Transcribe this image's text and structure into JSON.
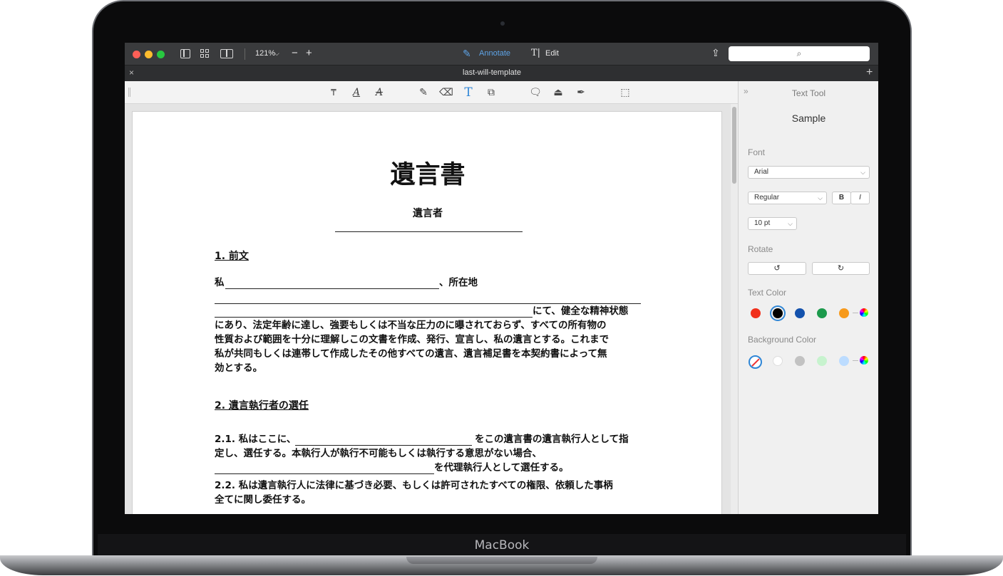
{
  "device": {
    "brand": "MacBook"
  },
  "window": {
    "zoom": "121%",
    "modes": {
      "annotate": "Annotate",
      "edit": "Edit"
    },
    "tab": {
      "title": "last-will-template"
    },
    "search_icon": "magnifier-icon"
  },
  "colors": {
    "accent": "#2f86d6",
    "traffic_red": "#fe5f57",
    "traffic_yellow": "#febc2e",
    "traffic_green": "#28c840"
  },
  "document": {
    "title": "遺言書",
    "testator": "遺言者",
    "sections": [
      {
        "heading": "1. 前文"
      },
      {
        "heading": "2. 遺言執行者の選任"
      }
    ],
    "p1_line1_a": "私",
    "p1_line1_b": "、所在地",
    "p1_line3_b": "にて、健全な精神状態",
    "p1_line4": "にあり、法定年齢に達し、強要もしくは不当な圧力のに曝されておらず、すべての所有物の",
    "p1_line5": "性質および範囲を十分に理解しこの文書を作成、発行、宣言し、私の遺言とする。これまで",
    "p1_line6": "私が共同もしくは連帯して作成したその他すべての遺言、遺言補足書を本契約書によって無",
    "p1_line7": "効とする。",
    "p21_a": "2.1. 私はここに、",
    "p21_b": "をこの遺言書の遺言執行人として指",
    "p21_line2": "定し、選任する。本執行人が執行不可能もしくは執行する意思がない場合、",
    "p21_line3_b": "を代理執行人として選任する。",
    "p22_line1": "2.2. 私は遺言執行人に法律に基づき必要、もしくは許可されたすべての権限、依頼した事柄",
    "p22_line2": "全てに関し委任する。"
  },
  "panel": {
    "title": "Text Tool",
    "sample": "Sample",
    "font_label": "Font",
    "font_value": "Arial",
    "style_value": "Regular",
    "bold": "B",
    "italic": "I",
    "size_value": "10 pt",
    "rotate_label": "Rotate",
    "text_color_label": "Text Color",
    "bg_color_label": "Background Color",
    "text_colors": [
      "#f1301b",
      "#000000",
      "#1452ad",
      "#1c9a4c",
      "#f79a1c"
    ],
    "bg_colors": [
      "#ffffff",
      "#c2c2c2",
      "#c7f3ce",
      "#bcdcff"
    ]
  }
}
